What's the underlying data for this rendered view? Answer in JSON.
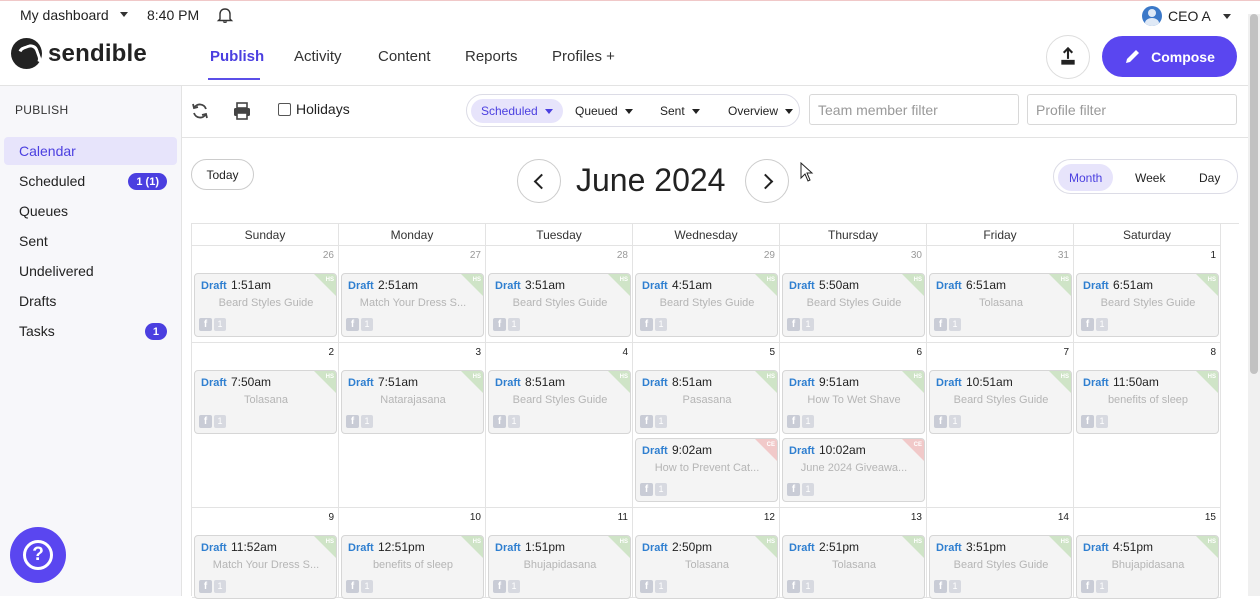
{
  "topbar": {
    "dashboard": "My dashboard",
    "time": "8:40 PM",
    "user": "CEO A"
  },
  "brand": {
    "name": "sendible"
  },
  "nav": {
    "tabs": [
      "Publish",
      "Activity",
      "Content",
      "Reports",
      "Profiles +"
    ],
    "active": "Publish",
    "compose": "Compose"
  },
  "sidebar": {
    "heading": "PUBLISH",
    "items": [
      {
        "label": "Calendar",
        "active": true,
        "badge": ""
      },
      {
        "label": "Scheduled",
        "badge": "1 (1)"
      },
      {
        "label": "Queues",
        "badge": ""
      },
      {
        "label": "Sent",
        "badge": ""
      },
      {
        "label": "Undelivered",
        "badge": ""
      },
      {
        "label": "Drafts",
        "badge": ""
      },
      {
        "label": "Tasks",
        "badge": "1"
      }
    ]
  },
  "toolbar": {
    "holidays": "Holidays",
    "filters": [
      {
        "label": "Scheduled",
        "active": true
      },
      {
        "label": "Queued"
      },
      {
        "label": "Sent"
      },
      {
        "label": "Overview"
      }
    ],
    "team_placeholder": "Team member filter",
    "profile_placeholder": "Profile filter"
  },
  "calendar": {
    "today": "Today",
    "month": "June 2024",
    "views": [
      {
        "label": "Month",
        "active": true
      },
      {
        "label": "Week"
      },
      {
        "label": "Day"
      }
    ],
    "weekdays": [
      "Sunday",
      "Monday",
      "Tuesday",
      "Wednesday",
      "Thursday",
      "Friday",
      "Saturday"
    ],
    "weeks": [
      [
        {
          "day": "26",
          "dim": true,
          "posts": [
            {
              "tag": "Draft",
              "time": "1:51am",
              "title": "Beard Styles Guide",
              "corner": "HS",
              "count": "1"
            }
          ]
        },
        {
          "day": "27",
          "dim": true,
          "posts": [
            {
              "tag": "Draft",
              "time": "2:51am",
              "title": "Match Your Dress S...",
              "corner": "HS",
              "count": "1"
            }
          ]
        },
        {
          "day": "28",
          "dim": true,
          "posts": [
            {
              "tag": "Draft",
              "time": "3:51am",
              "title": "Beard Styles Guide",
              "corner": "HS",
              "count": "1"
            }
          ]
        },
        {
          "day": "29",
          "dim": true,
          "posts": [
            {
              "tag": "Draft",
              "time": "4:51am",
              "title": "Beard Styles Guide",
              "corner": "HS",
              "count": "1"
            }
          ]
        },
        {
          "day": "30",
          "dim": true,
          "posts": [
            {
              "tag": "Draft",
              "time": "5:50am",
              "title": "Beard Styles Guide",
              "corner": "HS",
              "count": "1"
            }
          ]
        },
        {
          "day": "31",
          "dim": true,
          "posts": [
            {
              "tag": "Draft",
              "time": "6:51am",
              "title": "Tolasana",
              "corner": "HS",
              "count": "1"
            }
          ]
        },
        {
          "day": "1",
          "dim": false,
          "posts": [
            {
              "tag": "Draft",
              "time": "6:51am",
              "title": "Beard Styles Guide",
              "corner": "HS",
              "count": "1"
            }
          ]
        }
      ],
      [
        {
          "day": "2",
          "posts": [
            {
              "tag": "Draft",
              "time": "7:50am",
              "title": "Tolasana",
              "corner": "HS",
              "count": "1"
            }
          ]
        },
        {
          "day": "3",
          "posts": [
            {
              "tag": "Draft",
              "time": "7:51am",
              "title": "Natarajasana",
              "corner": "HS",
              "count": "1"
            }
          ]
        },
        {
          "day": "4",
          "posts": [
            {
              "tag": "Draft",
              "time": "8:51am",
              "title": "Beard Styles Guide",
              "corner": "HS",
              "count": "1"
            }
          ]
        },
        {
          "day": "5",
          "posts": [
            {
              "tag": "Draft",
              "time": "8:51am",
              "title": "Pasasana",
              "corner": "HS",
              "count": "1"
            },
            {
              "tag": "Draft",
              "time": "9:02am",
              "title": "How to Prevent Cat...",
              "corner": "CE",
              "count": "1"
            }
          ]
        },
        {
          "day": "6",
          "posts": [
            {
              "tag": "Draft",
              "time": "9:51am",
              "title": "How To Wet Shave",
              "corner": "HS",
              "count": "1"
            },
            {
              "tag": "Draft",
              "time": "10:02am",
              "title": "June 2024 Giveawa...",
              "corner": "CE",
              "count": "1"
            }
          ]
        },
        {
          "day": "7",
          "posts": [
            {
              "tag": "Draft",
              "time": "10:51am",
              "title": "Beard Styles Guide",
              "corner": "HS",
              "count": "1"
            }
          ]
        },
        {
          "day": "8",
          "posts": [
            {
              "tag": "Draft",
              "time": "11:50am",
              "title": "benefits of sleep",
              "corner": "HS",
              "count": "1"
            }
          ]
        }
      ],
      [
        {
          "day": "9",
          "posts": [
            {
              "tag": "Draft",
              "time": "11:52am",
              "title": "Match Your Dress S...",
              "corner": "HS",
              "count": "1"
            }
          ]
        },
        {
          "day": "10",
          "posts": [
            {
              "tag": "Draft",
              "time": "12:51pm",
              "title": "benefits of sleep",
              "corner": "HS",
              "count": "1"
            }
          ]
        },
        {
          "day": "11",
          "posts": [
            {
              "tag": "Draft",
              "time": "1:51pm",
              "title": "Bhujapidasana",
              "corner": "HS",
              "count": "1"
            }
          ]
        },
        {
          "day": "12",
          "posts": [
            {
              "tag": "Draft",
              "time": "2:50pm",
              "title": "Tolasana",
              "corner": "HS",
              "count": "1"
            }
          ]
        },
        {
          "day": "13",
          "posts": [
            {
              "tag": "Draft",
              "time": "2:51pm",
              "title": "Tolasana",
              "corner": "HS",
              "count": "1"
            }
          ]
        },
        {
          "day": "14",
          "posts": [
            {
              "tag": "Draft",
              "time": "3:51pm",
              "title": "Beard Styles Guide",
              "corner": "HS",
              "count": "1"
            }
          ]
        },
        {
          "day": "15",
          "posts": [
            {
              "tag": "Draft",
              "time": "4:51pm",
              "title": "Bhujapidasana",
              "corner": "HS",
              "count": "1"
            }
          ]
        }
      ]
    ]
  },
  "colors": {
    "accent": "#5a46f0",
    "draft_tag": "#2f7fd0",
    "hs_corner": "#cfe4c7",
    "ce_corner": "#f1c9c9"
  }
}
